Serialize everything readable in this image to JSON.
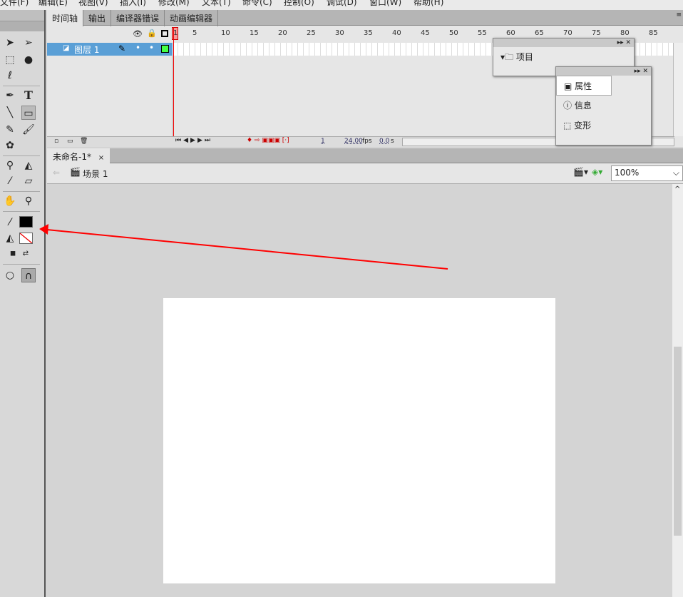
{
  "menu": [
    "文件(F)",
    "编辑(E)",
    "视图(V)",
    "插入(I)",
    "修改(M)",
    "文本(T)",
    "命令(C)",
    "控制(O)",
    "调试(D)",
    "窗口(W)",
    "帮助(H)"
  ],
  "timeline": {
    "tabs": [
      "时间轴",
      "输出",
      "编译器错误",
      "动画编辑器"
    ],
    "frame_numbers": [
      "1",
      "5",
      "10",
      "15",
      "20",
      "25",
      "30",
      "35",
      "40",
      "45",
      "50",
      "55",
      "60",
      "65",
      "70",
      "75",
      "80",
      "85"
    ],
    "layer_name": "图层 1",
    "current_frame": "1",
    "fps": "24.00",
    "fps_unit": "fps",
    "time": "0.0",
    "time_unit": "s"
  },
  "document": {
    "tab": "未命名-1*",
    "close": "×",
    "scene": "场景 1",
    "zoom": "100%"
  },
  "panels": {
    "project": "项目",
    "properties": "属性",
    "info": "信息",
    "transform": "变形"
  },
  "colors": {
    "stroke": "#000000",
    "fill": "none",
    "arrow": "#ff0000"
  }
}
